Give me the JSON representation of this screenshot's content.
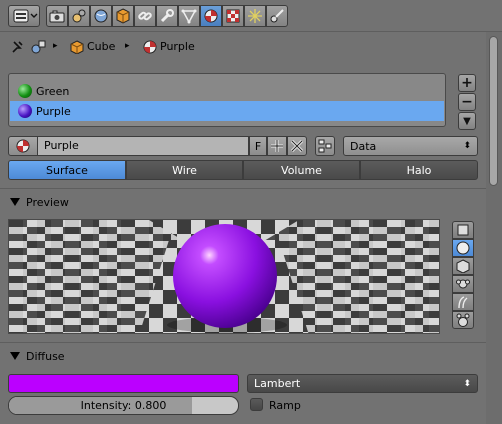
{
  "breadcrumb": {
    "object": "Cube",
    "material": "Purple"
  },
  "slots": [
    {
      "name": "Green",
      "color": "#1fa01f",
      "selected": false
    },
    {
      "name": "Purple",
      "color": "#4a16c4",
      "selected": true
    }
  ],
  "material_field": {
    "value": "Purple",
    "fake_user": "F"
  },
  "link_dropdown": {
    "value": "Data"
  },
  "tabs": [
    "Surface",
    "Wire",
    "Volume",
    "Halo"
  ],
  "active_tab": "Surface",
  "preview": {
    "title": "Preview"
  },
  "diffuse": {
    "title": "Diffuse",
    "color": "#bb00ff",
    "shader": "Lambert",
    "intensity_label": "Intensity: 0.800",
    "intensity": 0.8,
    "ramp_label": "Ramp"
  }
}
